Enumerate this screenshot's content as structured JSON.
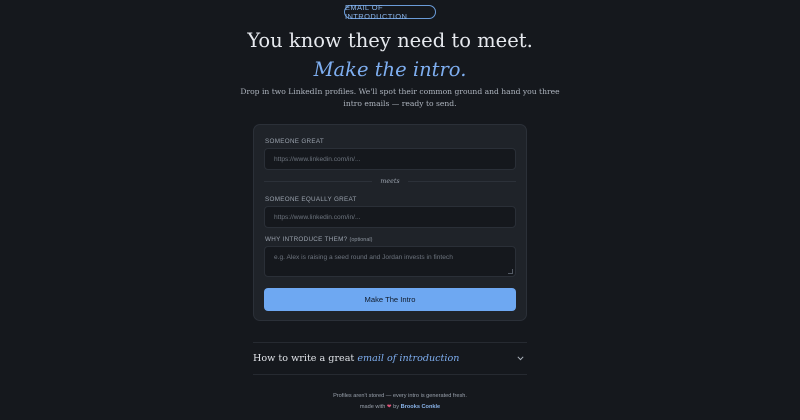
{
  "badge": "EMAIL OF INTRODUCTION",
  "headline": {
    "main": "You know they need to meet. ",
    "accent": "Make the intro."
  },
  "subtitle": "Drop in two LinkedIn profiles. We'll spot their common ground and hand you three intro emails — ready to send.",
  "form": {
    "person1_label": "SOMEONE GREAT",
    "person1_placeholder": "https://www.linkedin.com/in/...",
    "meets_label": "meets",
    "person2_label": "SOMEONE EQUALLY GREAT",
    "person2_placeholder": "https://www.linkedin.com/in/...",
    "reason_label": "WHY INTRODUCE THEM?",
    "reason_optional": "(optional)",
    "reason_placeholder": "e.g. Alex is raising a seed round and Jordan invests in fintech",
    "submit_label": "Make The Intro"
  },
  "guide": {
    "title_main": "How to write a great ",
    "title_accent": "email of introduction",
    "icon": "chevron-down-icon"
  },
  "footer": {
    "privacy": "Profiles aren't stored — every intro is generated fresh.",
    "made_with": "made with",
    "heart_icon": "heart-icon",
    "by": "by",
    "author": "Brooks Conkle"
  },
  "colors": {
    "background": "#15181d",
    "accent": "#7eaef0",
    "button": "#6ea8f2",
    "heart": "#e0567a"
  }
}
